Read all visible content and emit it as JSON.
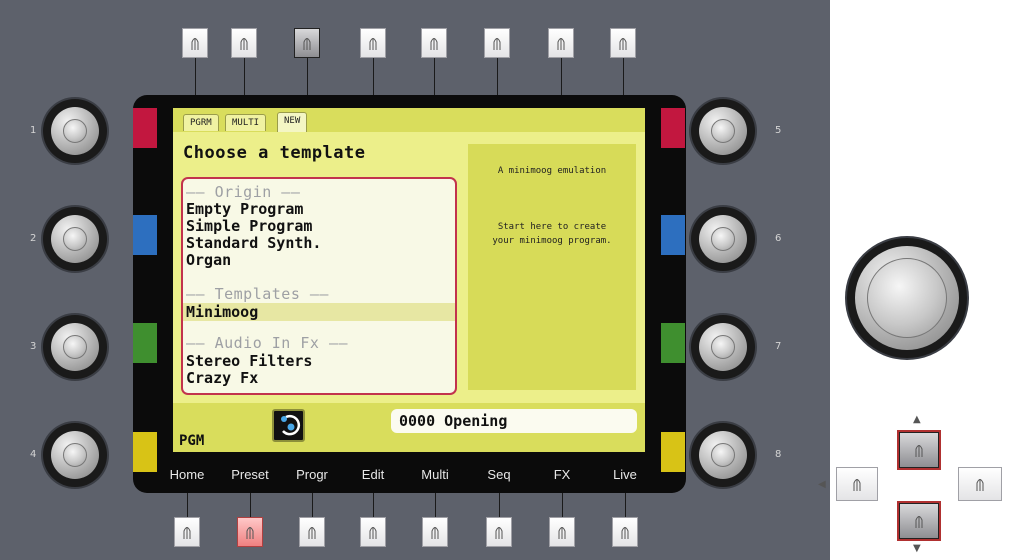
{
  "lcd": {
    "tabs": [
      "PGRM",
      "MULTI",
      "NEW"
    ],
    "active_tab": "NEW",
    "title": "Choose a template",
    "list": {
      "groups": [
        {
          "header": "—— Origin ——",
          "items": [
            "Empty Program",
            "Simple Program",
            "Standard Synth.",
            "Organ"
          ]
        },
        {
          "header": "—— Templates ——",
          "items": [
            "Minimoog"
          ]
        },
        {
          "header": "—— Audio In Fx ——",
          "items": [
            "Stereo Filters",
            "Crazy Fx"
          ]
        }
      ],
      "selected": "Minimoog"
    },
    "description": {
      "line1": "A minimoog emulation",
      "line2": "Start here to create",
      "line3": "your minimoog program."
    },
    "mode_label": "PGM",
    "status": "0000 Opening"
  },
  "knobs": {
    "numbers": [
      "1",
      "2",
      "3",
      "4",
      "5",
      "6",
      "7",
      "8"
    ],
    "strip_colors": [
      "#c2173f",
      "#2d6fbf",
      "#3f8f2f",
      "#d8c316"
    ]
  },
  "bottom_buttons": {
    "labels": [
      "Home",
      "Preset",
      "Progr",
      "Edit",
      "Multi",
      "Seq",
      "FX",
      "Live"
    ]
  },
  "colors": {
    "panel": "#5d616b",
    "lcd": "#ecef8a",
    "list_border": "#c2334d"
  }
}
